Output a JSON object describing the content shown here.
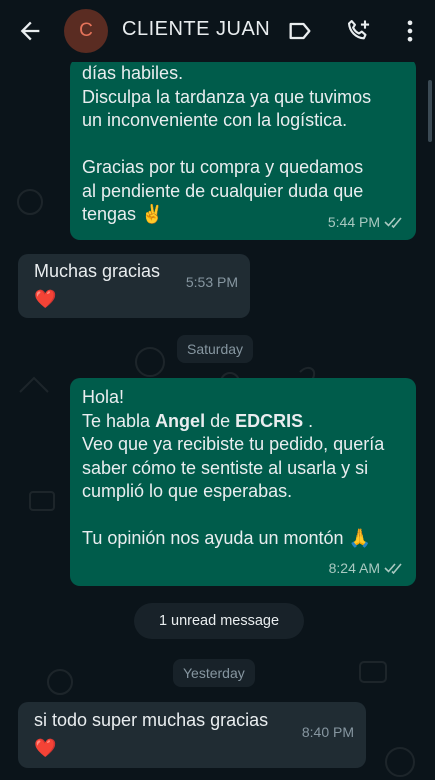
{
  "header": {
    "avatar_letter": "C",
    "contact_name": "CLIENTE JUAN",
    "icons": [
      "back-arrow-icon",
      "label-icon",
      "add-call-icon",
      "more-vert-icon"
    ]
  },
  "messages": [
    {
      "type": "outgoing",
      "text": "días habiles.\nDisculpa la tardanza ya que tuvimos\nun inconveniente con la logística.\n\nGracias por tu compra y quedamos\nal pendiente de cualquier duda que\ntengas ✌️",
      "time": "5:44 PM",
      "status": "read"
    },
    {
      "type": "incoming",
      "text": "Muchas gracias",
      "emoji": "❤️",
      "time": "5:53 PM"
    },
    {
      "type": "outgoing",
      "greeting": "Hola!",
      "line_prefix": "Te habla ",
      "name_bold": "Angel",
      "line_mid": " de ",
      "brand_bold": "EDCRIS",
      "line_suffix": " .",
      "body": "Veo que ya recibiste tu pedido, quería\nsaber cómo te sentiste al usarla y si\ncumplió lo que esperabas.\n\nTu opinión nos ayuda un montón 🙏",
      "time": "8:24 AM",
      "status": "read"
    },
    {
      "type": "incoming",
      "text": "si todo super muchas gracias",
      "emoji": "❤️",
      "time": "8:40 PM"
    }
  ],
  "date_chips": {
    "saturday": "Saturday",
    "yesterday": "Yesterday"
  },
  "unread_banner": "1 unread message",
  "colors": {
    "background": "#0b141a",
    "outgoing_bubble": "#005c4b",
    "incoming_bubble": "#202c33",
    "avatar_bg": "#5a2c22",
    "avatar_letter": "#e5735a"
  }
}
